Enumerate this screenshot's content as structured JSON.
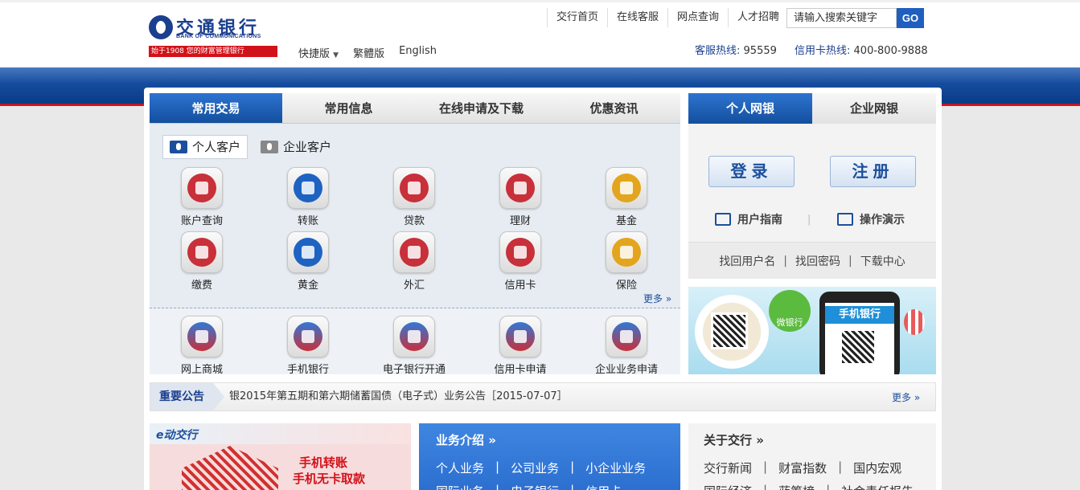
{
  "header": {
    "logo_cn": "交通银行",
    "logo_en": "BANK OF COMMUNICATIONS",
    "logo_slogan": "始于1908 您的财富管理银行",
    "langs": [
      "快捷版",
      "繁體版",
      "English"
    ],
    "top_links": [
      "交行首页",
      "在线客服",
      "网点查询",
      "人才招聘"
    ],
    "search_placeholder": "请输入搜索关键字",
    "go_label": "GO",
    "hotline_label": "客服热线:",
    "hotline_num": "95559",
    "card_label": "信用卡热线:",
    "card_num": "400-800-9888"
  },
  "tabs": [
    "常用交易",
    "常用信息",
    "在线申请及下载",
    "优惠资讯"
  ],
  "subtabs": [
    "个人客户",
    "企业客户"
  ],
  "services_row1": [
    "账户查询",
    "转账",
    "贷款",
    "理财",
    "基金"
  ],
  "services_row2": [
    "缴费",
    "黄金",
    "外汇",
    "信用卡",
    "保险"
  ],
  "services_row3": [
    "网上商城",
    "手机银行",
    "电子银行开通",
    "信用卡申请",
    "企业业务申请"
  ],
  "more_label": "更多 »",
  "right": {
    "tabs": [
      "个人网银",
      "企业网银"
    ],
    "login": "登录",
    "register": "注册",
    "guide": "用户指南",
    "demo": "操作演示",
    "links": [
      "找回用户名",
      "找回密码",
      "下载中心"
    ],
    "sep": "|"
  },
  "banner": {
    "wechat": "微银行",
    "mobile": "手机银行"
  },
  "notice": {
    "tag": "重要公告",
    "text": "银2015年第五期和第六期储蓄国债（电子式）业务公告［2015-07-07］",
    "more": "更多 »"
  },
  "promo": {
    "logo": "e动交行",
    "line1": "手机转账",
    "line2": "手机无卡取款"
  },
  "biz": {
    "title": "业务介绍 »",
    "links": [
      "个人业务",
      "|",
      "公司业务",
      "|",
      "小企业业务"
    ],
    "links2": [
      "国际业务",
      "|",
      "电子银行",
      "|",
      "信用卡"
    ]
  },
  "about": {
    "title": "关于交行 »",
    "links": [
      "交行新闻",
      "|",
      "财富指数",
      "|",
      "国内宏观"
    ],
    "links2": [
      "国际经济",
      "|",
      "蓝筹榜",
      "|",
      "社会责任报告"
    ]
  },
  "colors": {
    "brand_blue": "#1b3f8f",
    "accent_red": "#d2121a",
    "tab_blue": "#1e5fbf"
  }
}
